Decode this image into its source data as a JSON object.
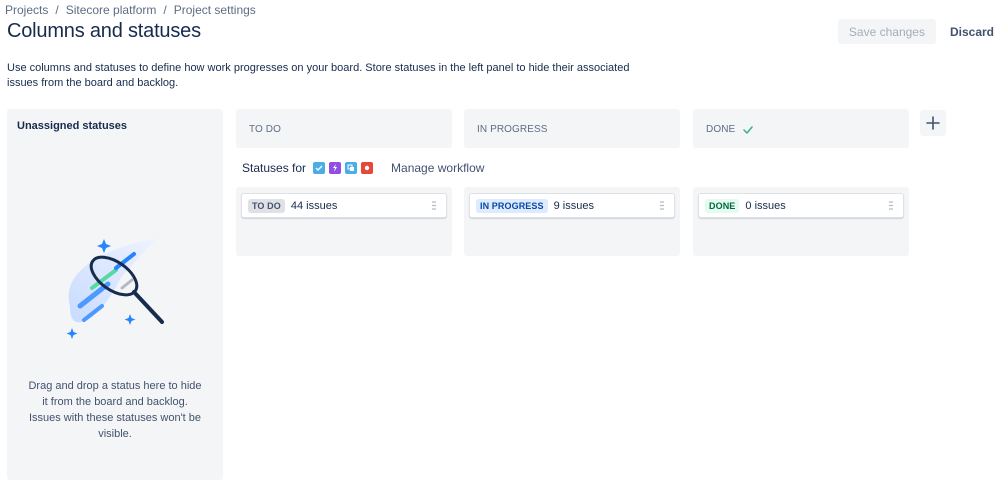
{
  "breadcrumb": {
    "items": [
      "Projects",
      "Sitecore platform",
      "Project settings"
    ],
    "separator": "/"
  },
  "page": {
    "title": "Columns and statuses",
    "description": "Use columns and statuses to define how work progresses on your board. Store statuses in the left panel to hide their associated issues from the board and backlog."
  },
  "actions": {
    "save_label": "Save changes",
    "discard_label": "Discard"
  },
  "unassigned": {
    "title": "Unassigned statuses",
    "help_text": "Drag and drop a status here to hide it from the board and backlog. Issues with these statuses won't be visible."
  },
  "columns": [
    {
      "name": "TO DO",
      "status": {
        "lozenge": "TO DO",
        "count": "44 issues"
      }
    },
    {
      "name": "IN PROGRESS",
      "status": {
        "lozenge": "IN PROGRESS",
        "count": "9 issues"
      }
    },
    {
      "name": "DONE",
      "status": {
        "lozenge": "DONE",
        "count": "0 issues"
      }
    }
  ],
  "statuses_for": {
    "label": "Statuses for",
    "issue_types": [
      {
        "icon": "task-icon",
        "color": "#4bade8"
      },
      {
        "icon": "epic-icon",
        "color": "#904ee2"
      },
      {
        "icon": "subtask-icon",
        "color": "#4bade8"
      },
      {
        "icon": "bug-icon",
        "color": "#e5493a"
      }
    ],
    "manage_label": "Manage workflow"
  },
  "colors": {
    "accent": "#0052cc",
    "panel_bg": "#f4f5f7",
    "done_check": "#36b37e"
  }
}
